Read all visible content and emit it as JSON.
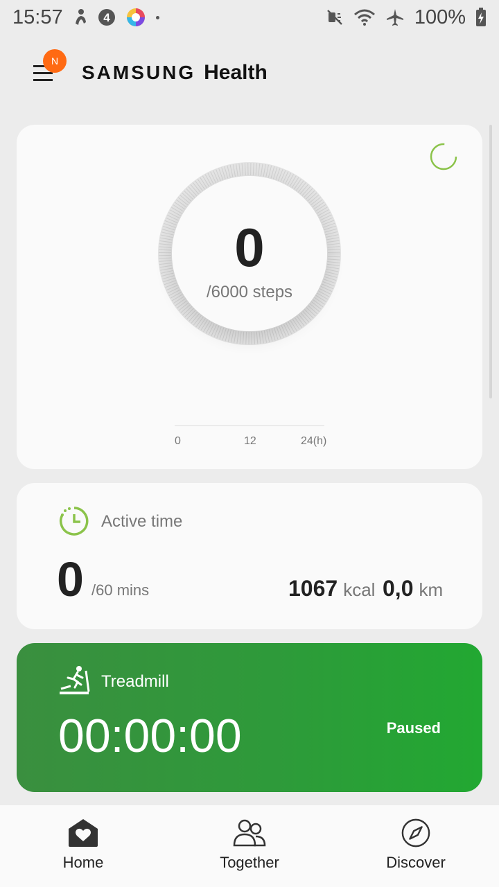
{
  "status_bar": {
    "time": "15:57",
    "battery": "100%",
    "icons": [
      "notification-figure-icon",
      "badge-4-icon",
      "app-colorful-icon",
      "mute-icon",
      "wifi-icon",
      "airplane-icon",
      "battery-charging-icon"
    ]
  },
  "header": {
    "menu_badge": "N",
    "brand_samsung": "SAMSUNG",
    "brand_health": "Health"
  },
  "steps": {
    "value": "0",
    "goal": "/6000 steps",
    "timeline_ticks": [
      "0",
      "12",
      "24(h)"
    ]
  },
  "active_time": {
    "label": "Active time",
    "value": "0",
    "goal": "/60 mins",
    "kcal_value": "1067",
    "kcal_unit": "kcal",
    "km_value": "0,0",
    "km_unit": "km"
  },
  "treadmill": {
    "label": "Treadmill",
    "time": "00:00:00",
    "status": "Paused"
  },
  "nav": {
    "items": [
      {
        "label": "Home"
      },
      {
        "label": "Together"
      },
      {
        "label": "Discover"
      }
    ]
  },
  "colors": {
    "accent_green": "#2e9a3a",
    "icon_green": "#8bc34a",
    "badge_orange": "#ff6a13"
  }
}
